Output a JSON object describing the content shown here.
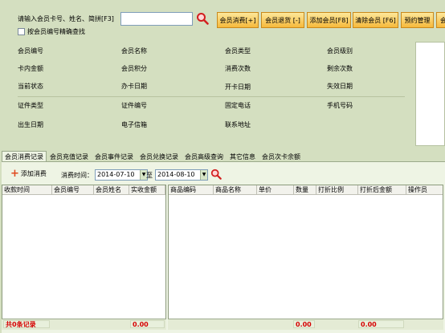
{
  "search": {
    "label": "请输入会员卡号、姓名、简拼[F3]",
    "value": "",
    "exact_label": "按会员编号精确查找"
  },
  "toolbar": [
    "会员消费[+]",
    "会员退货 [-]",
    "添加会员[F8]",
    "清除会员 [F6]",
    "预约管理",
    "会"
  ],
  "fields": {
    "row1": [
      "会员编号",
      "会员名称",
      "会员类型",
      "会员级别"
    ],
    "row2": [
      "卡内金额",
      "会员积分",
      "消费次数",
      "剩余次数"
    ],
    "row3": [
      "当前状态",
      "办卡日期",
      "开卡日期",
      "失效日期"
    ],
    "row4": [
      "证件类型",
      "证件编号",
      "固定电话",
      "手机号码"
    ],
    "row5": [
      "出生日期",
      "电子信箱",
      "联系地址"
    ]
  },
  "tabs": [
    "会员消费记录",
    "会员充值记录",
    "会员事件记录",
    "会员兑换记录",
    "会员高级查询",
    "其它信息",
    "会员次卡余额"
  ],
  "filter": {
    "add_label": "添加消费",
    "time_label": "消费时间：",
    "from_date": "2014-07-10",
    "to_label": "至",
    "to_date": "2014-08-10"
  },
  "left_table": {
    "columns": [
      "收款时间",
      "会员编号",
      "会员姓名",
      "实收金额"
    ]
  },
  "right_table": {
    "columns": [
      "商品编码",
      "商品名称",
      "单价",
      "数量",
      "打折比例",
      "打折后金额",
      "操作员"
    ]
  },
  "footer": {
    "record_count": "共0条记录",
    "left_total": "0.00",
    "qty_total": "0.00",
    "amount_total": "0.00"
  },
  "colors": {
    "accent": "#f6b93b",
    "total_red": "#d50000"
  }
}
